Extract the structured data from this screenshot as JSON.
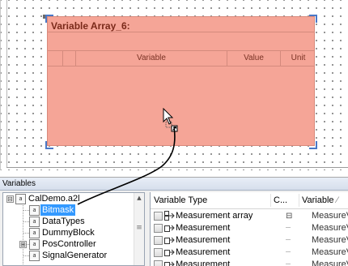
{
  "canvas": {
    "widget_title": "Variable Array_6:",
    "columns": [
      "",
      "",
      "Variable",
      "Value",
      "Unit"
    ]
  },
  "panel": {
    "title": "Variables"
  },
  "tree": {
    "items": [
      {
        "label": "CalDemo.a2l",
        "icon": "a2l",
        "expander": "⊟",
        "selected": false
      },
      {
        "label": "Bitmask",
        "icon": "a2l",
        "expander": "",
        "selected": true
      },
      {
        "label": "DataTypes",
        "icon": "a2l",
        "expander": "",
        "selected": false
      },
      {
        "label": "DummyBlock",
        "icon": "a2l",
        "expander": "",
        "selected": false
      },
      {
        "label": "PosController",
        "icon": "a2l",
        "expander": "⊞",
        "selected": false
      },
      {
        "label": "SignalGenerator",
        "icon": "a2l",
        "expander": "",
        "selected": false
      }
    ],
    "scroll_up": "▲",
    "scroll_grip": "≡"
  },
  "grid": {
    "headers": {
      "variable_type": "Variable Type",
      "c": "C...",
      "variable": "Variable",
      "sort_mark": "⁄"
    },
    "rows": [
      {
        "type": "Measurement array",
        "expand": "⊟",
        "variable": "MeasureV"
      },
      {
        "type": "Measurement",
        "expand": "┄",
        "variable": "MeasureV"
      },
      {
        "type": "Measurement",
        "expand": "┄",
        "variable": "MeasureV"
      },
      {
        "type": "Measurement",
        "expand": "┄",
        "variable": "MeasureV"
      },
      {
        "type": "Measurement",
        "expand": "┄",
        "variable": "MeasureV"
      }
    ]
  },
  "colors": {
    "widget_fill": "#f5a597",
    "selection": "#3399ff",
    "handle": "#4a78c6"
  }
}
